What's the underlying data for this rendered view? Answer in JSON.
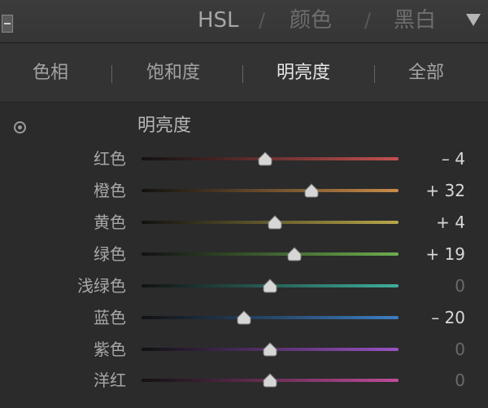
{
  "header": {
    "hsl": "HSL",
    "sep1": "/",
    "color": "颜色",
    "sep2": "/",
    "bw": "黑白"
  },
  "tabs": [
    {
      "label": "色相"
    },
    {
      "label": "饱和度"
    },
    {
      "label": "明亮度"
    },
    {
      "label": "全部"
    }
  ],
  "active_tab": "明亮度",
  "section": {
    "title": "明亮度"
  },
  "sliders": [
    {
      "label": "红色",
      "value": "– 4",
      "num": -4,
      "color": "#c45050"
    },
    {
      "label": "橙色",
      "value": "+ 32",
      "num": 32,
      "color": "#c98c4a"
    },
    {
      "label": "黄色",
      "value": "+ 4",
      "num": 4,
      "color": "#b8a64a"
    },
    {
      "label": "绿色",
      "value": "+ 19",
      "num": 19,
      "color": "#6cae4e"
    },
    {
      "label": "浅绿色",
      "value": "0",
      "num": 0,
      "color": "#3fae9c"
    },
    {
      "label": "蓝色",
      "value": "– 20",
      "num": -20,
      "color": "#3c7ec2"
    },
    {
      "label": "紫色",
      "value": "0",
      "num": 0,
      "color": "#9a52c4"
    },
    {
      "label": "洋红",
      "value": "0",
      "num": 0,
      "color": "#c04c9a"
    }
  ]
}
